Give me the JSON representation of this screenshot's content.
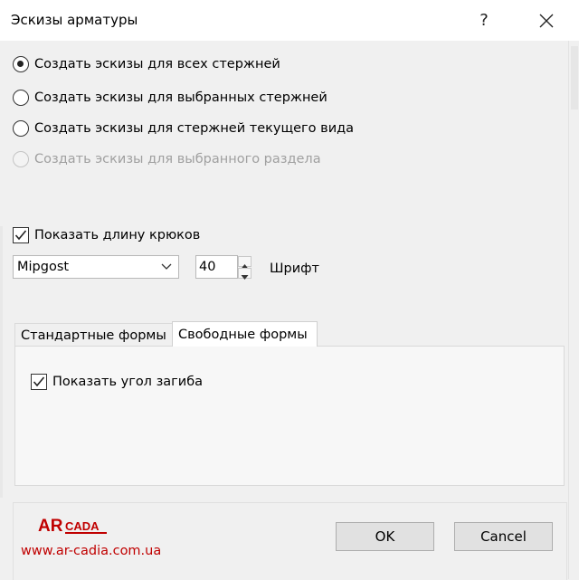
{
  "window": {
    "title": "Эскизы арматуры",
    "help_label": "?"
  },
  "options": {
    "radios": [
      {
        "label": "Создать эскизы для всех стержней",
        "checked": true,
        "enabled": true
      },
      {
        "label": "Создать эскизы для выбранных стержней",
        "checked": false,
        "enabled": true
      },
      {
        "label": "Создать эскизы для стержней текущего вида",
        "checked": false,
        "enabled": true
      },
      {
        "label": "Создать эскизы для выбранного раздела",
        "checked": false,
        "enabled": false
      }
    ],
    "show_hook_length": {
      "label": "Показать длину крюков",
      "checked": true
    }
  },
  "font": {
    "family_value": "Mipgost",
    "size_value": "40",
    "label": "Шрифт"
  },
  "tabs": [
    {
      "label": "Стандартные формы",
      "active": false
    },
    {
      "label": "Свободные формы",
      "active": true
    }
  ],
  "tab_content": {
    "show_bend_angle": {
      "label": "Показать угол загиба",
      "checked": true
    }
  },
  "footer": {
    "logo_text_ar": "AR",
    "logo_text_cada": "CADA",
    "site": "www.ar-cadia.com.ua",
    "ok_label": "OK",
    "cancel_label": "Cancel",
    "brand_color": "#c00000"
  }
}
